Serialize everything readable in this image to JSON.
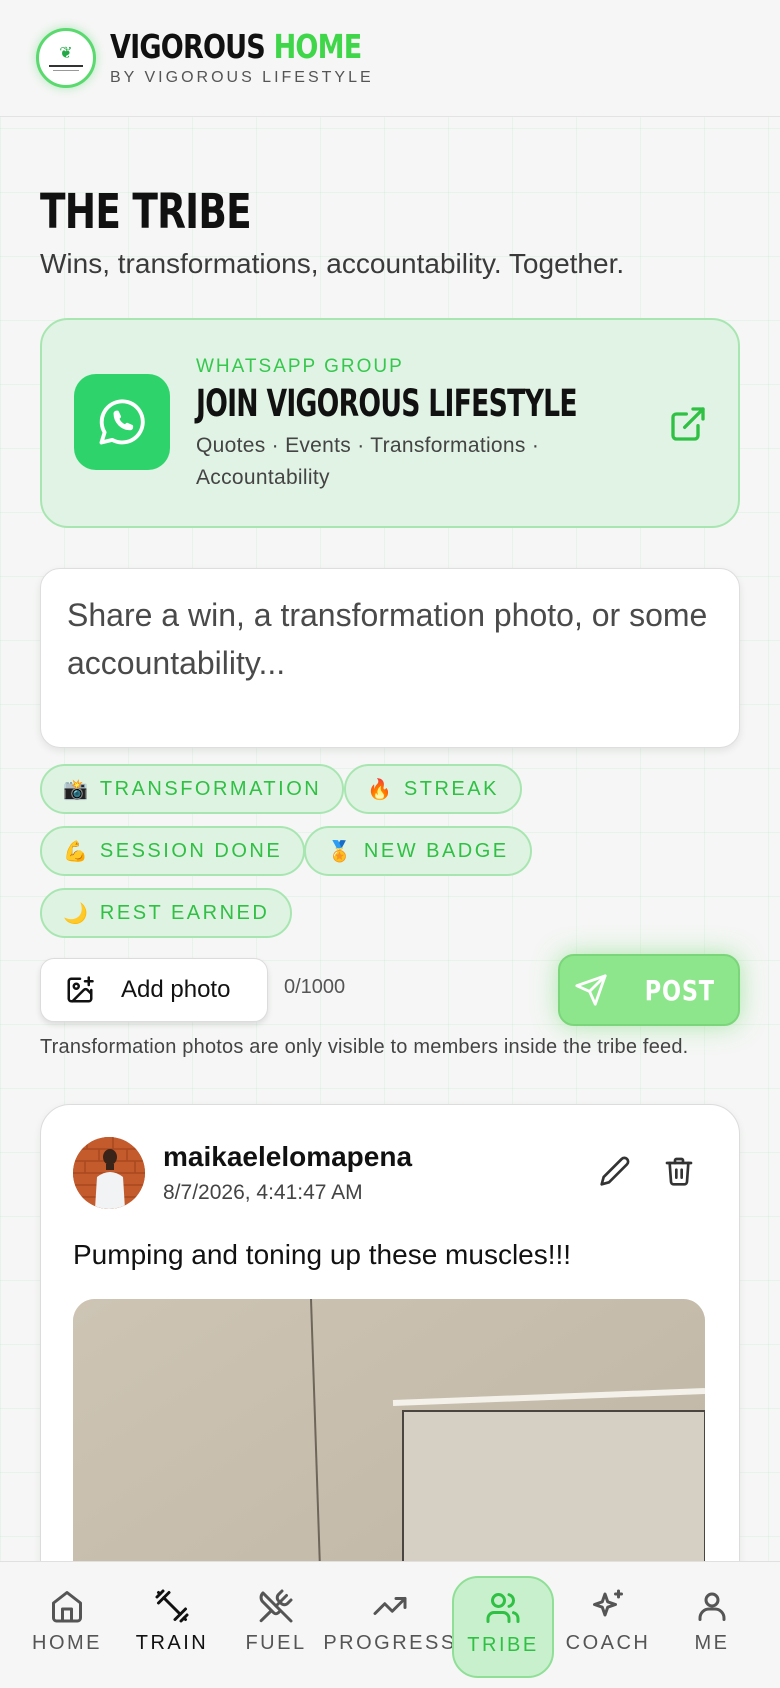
{
  "header": {
    "brand_primary": "VIGOROUS",
    "brand_accent": "HOME",
    "brand_subtitle": "BY VIGOROUS LIFESTYLE",
    "logo_icon": "leaf-logo"
  },
  "page": {
    "title": "THE TRIBE",
    "subtitle": "Wins, transformations, accountability. Together."
  },
  "whatsapp": {
    "eyebrow": "WHATSAPP GROUP",
    "title": "JOIN VIGOROUS LIFESTYLE",
    "description": "Quotes · Events · Transformations · Accountability",
    "icon": "whatsapp-icon",
    "action_icon": "external-link-icon"
  },
  "composer": {
    "placeholder": "Share a win, a transformation photo, or some accountability..."
  },
  "tags": [
    {
      "emoji": "📸",
      "label": "TRANSFORMATION"
    },
    {
      "emoji": "🔥",
      "label": "STREAK"
    },
    {
      "emoji": "💪",
      "label": "SESSION DONE"
    },
    {
      "emoji": "🏅",
      "label": "NEW BADGE"
    },
    {
      "emoji": "🌙",
      "label": "REST EARNED"
    }
  ],
  "actions": {
    "add_photo_label": "Add photo",
    "char_count": "0/1000",
    "post_label": "POST",
    "privacy_note": "Transformation photos are only visible to members inside the tribe feed."
  },
  "post": {
    "username": "maikaelelomapena",
    "timestamp": "8/7/2026, 4:41:47 AM",
    "text": "Pumping and toning up these muscles!!!"
  },
  "nav": [
    {
      "label": "HOME",
      "icon": "home-icon",
      "active": false
    },
    {
      "label": "TRAIN",
      "icon": "dumbbell-icon",
      "active": false
    },
    {
      "label": "FUEL",
      "icon": "utensils-icon",
      "active": false
    },
    {
      "label": "PROGRESS",
      "icon": "trending-up-icon",
      "active": false
    },
    {
      "label": "TRIBE",
      "icon": "users-icon",
      "active": true
    },
    {
      "label": "COACH",
      "icon": "sparkles-icon",
      "active": false
    },
    {
      "label": "ME",
      "icon": "user-icon",
      "active": false
    }
  ],
  "colors": {
    "accent_green": "#3fd64a",
    "whatsapp_green": "#2ed46b",
    "card_tint": "#e1f3e4",
    "post_button": "#8ee68c"
  }
}
